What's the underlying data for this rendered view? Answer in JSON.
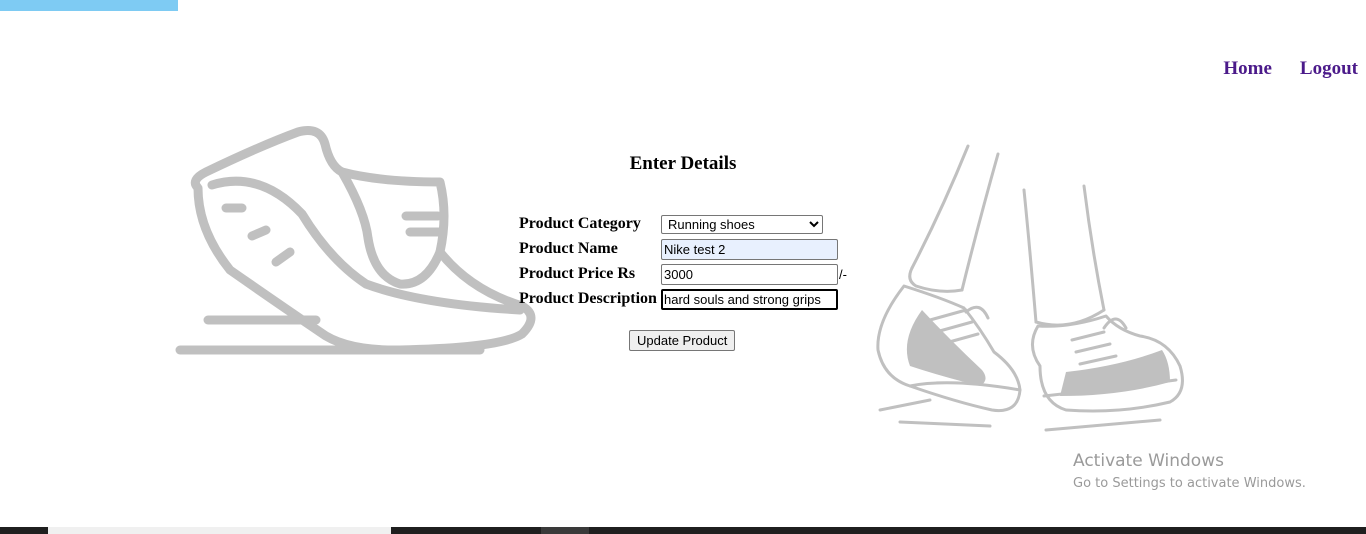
{
  "nav": {
    "home": "Home",
    "logout": "Logout"
  },
  "form": {
    "title": "Enter Details",
    "category": {
      "label": "Product Category",
      "selected": "Running shoes"
    },
    "name": {
      "label": "Product Name",
      "value": "Nike test 2"
    },
    "price": {
      "label": "Product Price Rs",
      "value": "3000",
      "suffix": "/-"
    },
    "description": {
      "label": "Product Description",
      "value": "hard souls and strong grips"
    },
    "submit": "Update Product"
  },
  "watermark": {
    "line1": "Activate Windows",
    "line2": "Go to Settings to activate Windows."
  },
  "colors": {
    "nav_link": "#4b1a8a",
    "illustration": "#c0c0c0",
    "top_strip": "#7ecbf3"
  }
}
